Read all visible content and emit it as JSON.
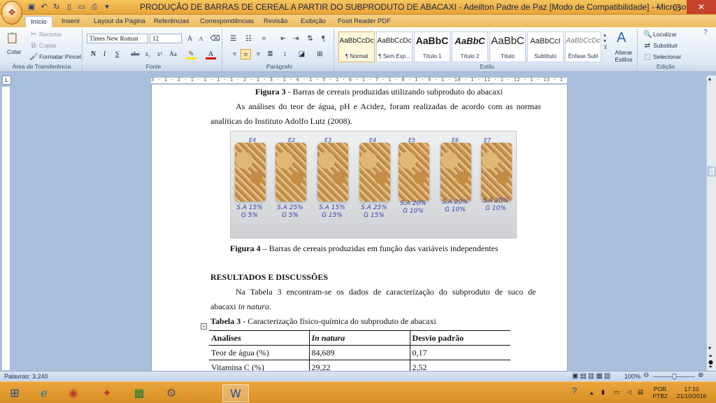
{
  "window": {
    "title": "PRODUÇÃO DE BARRAS DE CEREAL A PARTIR DO SUBPRODUTO DE ABACAXI - Adeilton Padre de Paz [Modo de Compatibilidade] - Microsoft Word",
    "minimize": "–",
    "maximize": "□",
    "close": "✕"
  },
  "tabs": [
    "Início",
    "Inserir",
    "Layout da Página",
    "Referências",
    "Correspondências",
    "Revisão",
    "Exibição",
    "Foxit Reader PDF"
  ],
  "ribbon": {
    "clipboard": {
      "label": "Área de Transferência",
      "paste": "Colar",
      "cut": "Recortar",
      "copy": "Copiar",
      "format_painter": "Formatar Pincel"
    },
    "font": {
      "label": "Fonte",
      "family": "Times New Roman",
      "size": "12"
    },
    "paragraph": {
      "label": "Parágrafo"
    },
    "styles": {
      "label": "Estilo",
      "items": [
        {
          "preview": "AaBbCcDc",
          "name": "¶ Normal"
        },
        {
          "preview": "AaBbCcDc",
          "name": "¶ Sem Esp..."
        },
        {
          "preview": "AaBbC",
          "name": "Título 1"
        },
        {
          "preview": "AaBbC",
          "name": "Título 2"
        },
        {
          "preview": "AaBbC",
          "name": "Título"
        },
        {
          "preview": "AaBbCcI",
          "name": "Subtítulo"
        },
        {
          "preview": "AaBbCcDc",
          "name": "Ênfase Sutil"
        }
      ],
      "change": "Alterar Estilos"
    },
    "editing": {
      "label": "Edição",
      "find": "Localizar",
      "replace": "Substituir",
      "select": "Selecionar"
    }
  },
  "ruler": "3 · 1 · 2 · 1 · 1 · 1 · 1 · 2 · 1 · 3 · 1 · 4 · 1 · 5 · 1 · 6 · 1 · 7 · 1 · 8 · 1 · 9 · 1 · 10 · 1 · 11 · 1 · 12 · 1 · 13 · 1 · 14 · 1 · 15 · 1 · 16 · 1 · 17",
  "doc": {
    "fig3": {
      "bold": "Figura 3",
      "rest": " - Barras de cereais produzidas utilizando subproduto do abacaxi"
    },
    "para1a": "As análises do teor de água, pH e Acidez, foram realizadas de acordo com as normas",
    "para1b": "analíticas do Instituto Adolfo Lutz (2008).",
    "fig4": {
      "bold": "Figura 4",
      "rest": " – Barras de cereais produzidas em função das variáveis independentes"
    },
    "photo": {
      "bar_labels": [
        "E4",
        "E2",
        "E3",
        "E4",
        "E5",
        "E6",
        "E7"
      ],
      "labels": [
        [
          "S.A 15%",
          "G 5%"
        ],
        [
          "S.A 25%",
          "G 5%"
        ],
        [
          "S.A 15%",
          "G 15%"
        ],
        [
          "S.A 25%",
          "G 15%"
        ],
        [
          "S.A 20%",
          "G 10%"
        ],
        [
          "S.A 20%",
          "G 10%"
        ],
        [
          "S.A 20%",
          "G 10%"
        ]
      ]
    },
    "heading": "RESULTADOS E DISCUSSÕES",
    "para2a": "Na Tabela 3 encontram-se os dados de caracterização do subproduto de suco de",
    "para2b": "abacaxi ",
    "para2b_italic": "in natura",
    "para2b_end": ".",
    "table_caption": {
      "bold": "Tabela 3",
      "rest": " - Caracterização físico-química do subproduto de abacaxi"
    },
    "table": {
      "headers": [
        "Analises",
        "In natura",
        "Desvio padrão"
      ],
      "rows": [
        [
          "Teor de água (%)",
          "84,689",
          "0,17"
        ],
        [
          "Vitamina C (%)",
          "29,22",
          "2,52"
        ]
      ]
    }
  },
  "status": {
    "words": "Palavras: 3.240",
    "zoom": "100%"
  },
  "taskbar": {
    "lang": "POR",
    "kbd": "PTB2",
    "time": "17:10",
    "date": "21/10/2016"
  }
}
